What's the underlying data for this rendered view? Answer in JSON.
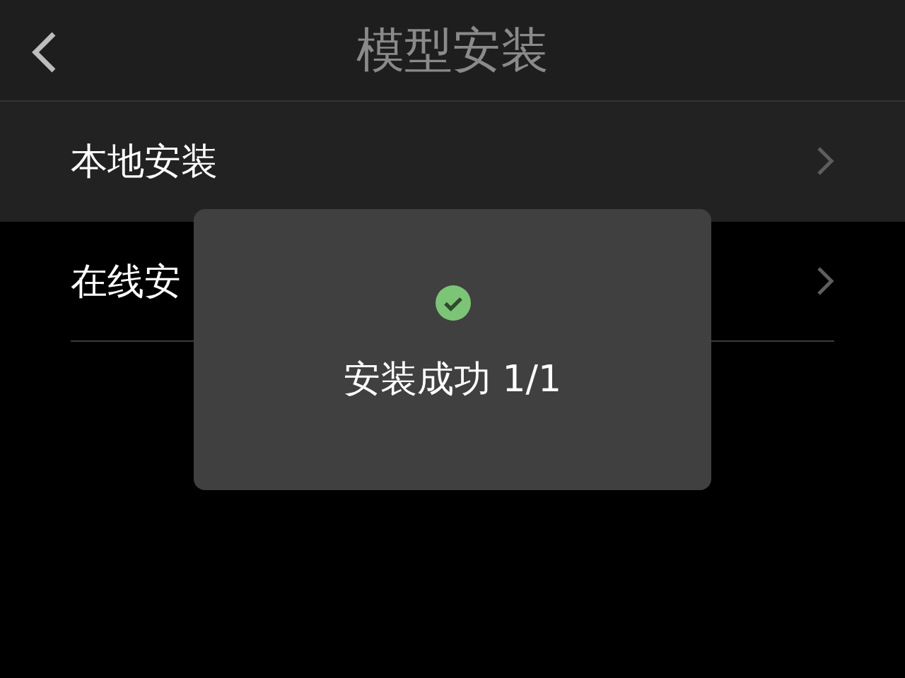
{
  "header": {
    "title": "模型安装"
  },
  "items": [
    {
      "label": "本地安装",
      "selected": true
    },
    {
      "label": "在线安",
      "selected": false
    }
  ],
  "toast": {
    "message": "安装成功 1/1"
  }
}
